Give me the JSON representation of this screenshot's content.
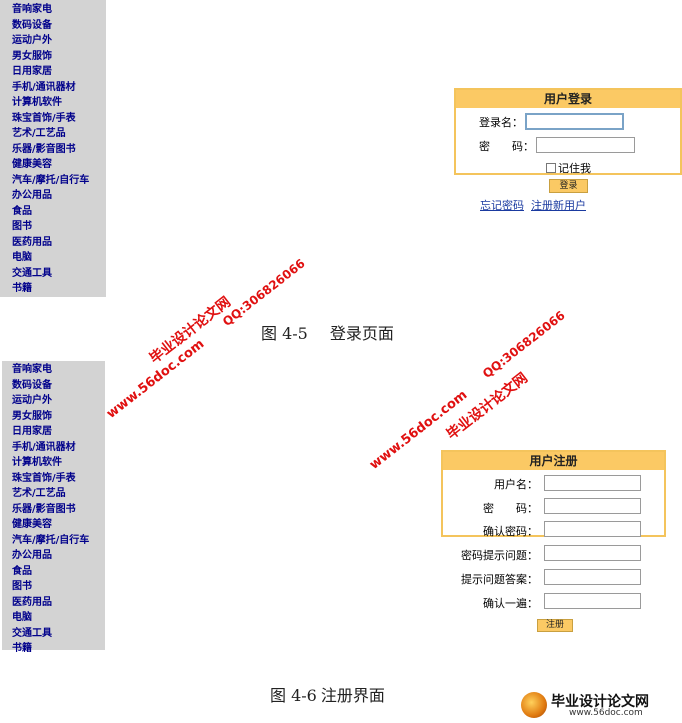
{
  "categories": [
    "音响家电",
    "数码设备",
    "运动户外",
    "男女服饰",
    "日用家居",
    "手机/通讯器材",
    "计算机软件",
    "珠宝首饰/手表",
    "艺术/工艺品",
    "乐器/影音图书",
    "健康美容",
    "汽车/摩托/自行车",
    "办公用品",
    "食品",
    "图书",
    "医药用品",
    "电脑",
    "交通工具",
    "书籍"
  ],
  "figure1": {
    "number": "图 4-5",
    "title": "登录页面"
  },
  "figure2": {
    "number": "图 4-6",
    "title": "注册界面"
  },
  "login": {
    "title": "用户登录",
    "username_label": "登录名：",
    "password_label": "密　　码：",
    "remember_label": "记住我",
    "submit_label": "登录",
    "forgot_link": "忘记密码",
    "register_link": "注册新用户"
  },
  "register": {
    "title": "用户注册",
    "fields": [
      "用户名：",
      "密　　码：",
      "确认密码：",
      "密码提示问题：",
      "提示问题答案：",
      "确认一遍："
    ],
    "submit_label": "注册"
  },
  "watermarks": {
    "site_cn": "毕业设计论文网",
    "site_url": "www.56doc.com",
    "qq": "QQ:306826066"
  },
  "logo": {
    "name": "毕业设计论文网",
    "url": "www.56doc.com"
  }
}
